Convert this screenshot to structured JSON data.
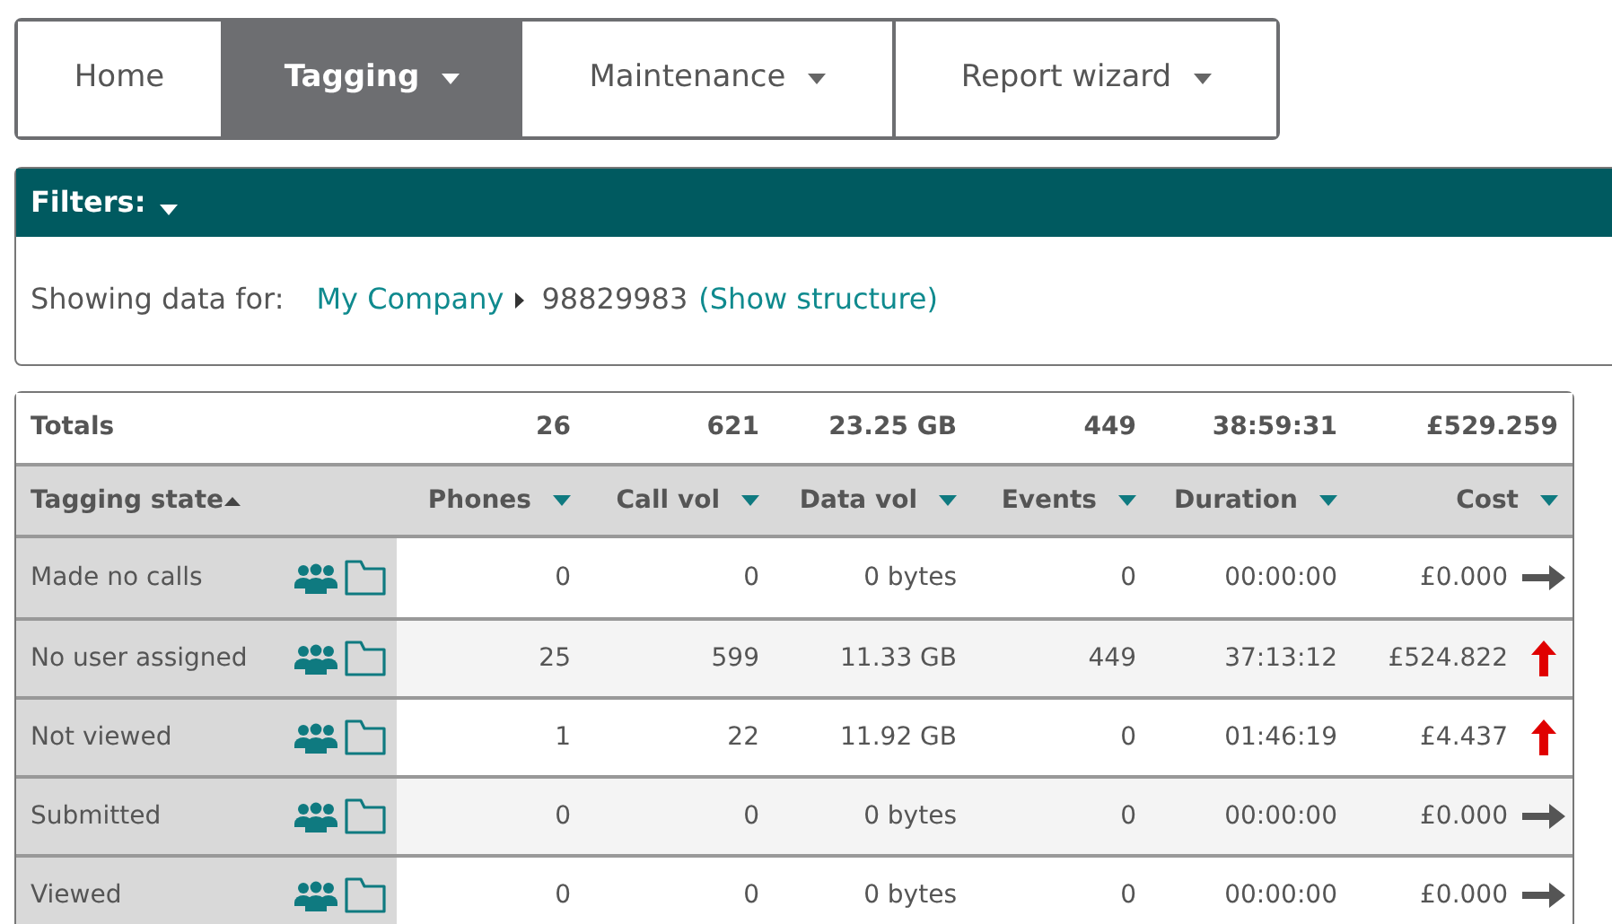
{
  "nav": [
    {
      "label": "Home",
      "selected": false,
      "dropdown": false
    },
    {
      "label": "Tagging",
      "selected": true,
      "dropdown": true
    },
    {
      "label": "Maintenance",
      "selected": false,
      "dropdown": true
    },
    {
      "label": "Report wizard",
      "selected": false,
      "dropdown": true
    }
  ],
  "filters": {
    "title": "Filters:",
    "expanded": false,
    "showing_label": "Showing data for:",
    "company": "My Company",
    "account": "98829983",
    "structure_link": "(Show structure)"
  },
  "table": {
    "totals": {
      "label": "Totals",
      "values": [
        "26",
        "621",
        "23.25 GB",
        "449",
        "38:59:31",
        "£529.259"
      ]
    },
    "columns": [
      {
        "label": "Tagging state",
        "sorted": true
      },
      {
        "label": "Phones",
        "sorted": false
      },
      {
        "label": "Call vol",
        "sorted": false
      },
      {
        "label": "Data vol",
        "sorted": false
      },
      {
        "label": "Events",
        "sorted": false
      },
      {
        "label": "Duration",
        "sorted": false
      },
      {
        "label": "Cost",
        "sorted": false
      }
    ],
    "rows": [
      {
        "state": "Made no calls",
        "values": [
          "0",
          "0",
          "0 bytes",
          "0",
          "00:00:00",
          "£0.000"
        ],
        "rising": false
      },
      {
        "state": "No user assigned",
        "values": [
          "25",
          "599",
          "11.33 GB",
          "449",
          "37:13:12",
          "£524.822"
        ],
        "rising": true
      },
      {
        "state": "Not viewed",
        "values": [
          "1",
          "22",
          "11.92 GB",
          "0",
          "01:46:19",
          "£4.437"
        ],
        "rising": true
      },
      {
        "state": "Submitted",
        "values": [
          "0",
          "0",
          "0 bytes",
          "0",
          "00:00:00",
          "£0.000"
        ],
        "rising": false
      },
      {
        "state": "Viewed",
        "values": [
          "0",
          "0",
          "0 bytes",
          "0",
          "00:00:00",
          "£0.000"
        ],
        "rising": false
      }
    ]
  }
}
